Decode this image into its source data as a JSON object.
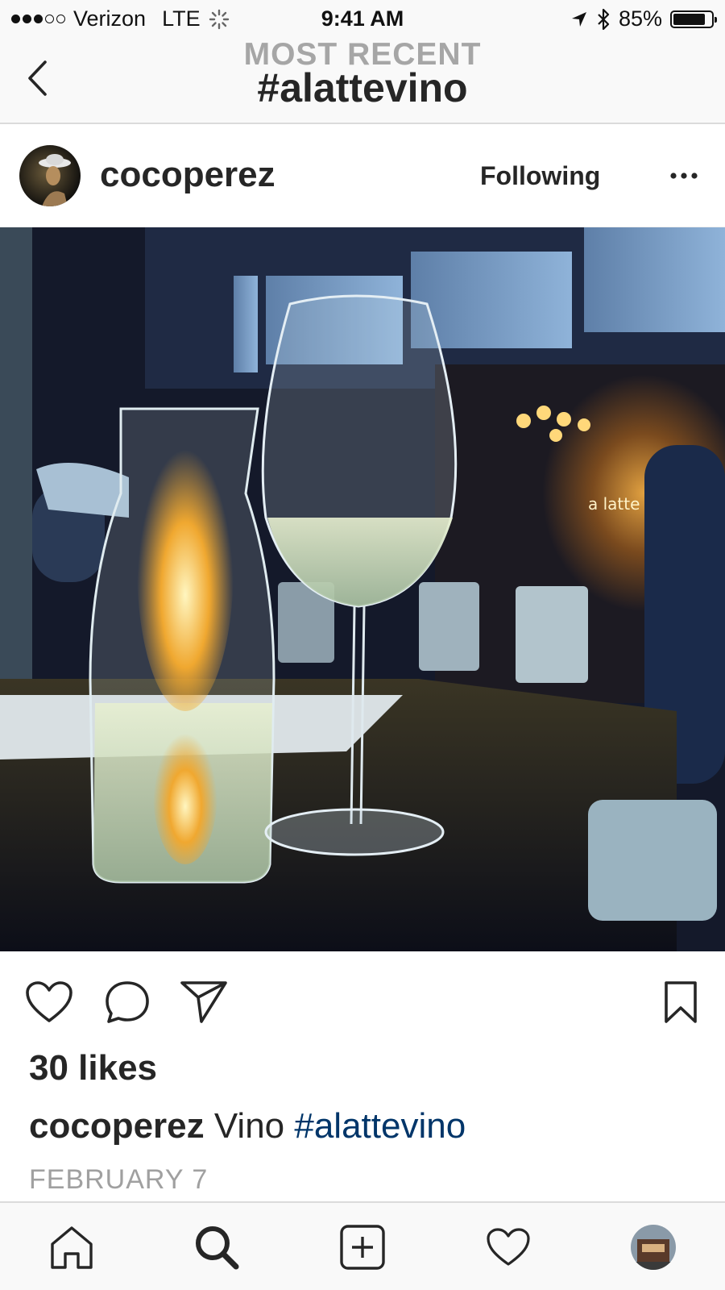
{
  "status_bar": {
    "carrier": "Verizon",
    "network": "LTE",
    "time": "9:41 AM",
    "battery": "85%",
    "battery_level": 0.85,
    "signal_bars_filled": 3,
    "signal_bars_total": 5
  },
  "nav": {
    "subtitle": "MOST RECENT",
    "title": "#alattevino",
    "back_icon": "chevron-left-icon"
  },
  "post": {
    "username": "cocoperez",
    "follow_state": "Following",
    "more_icon": "ellipsis-icon",
    "image_description_icon": "photo",
    "likes": "30 likes",
    "caption": {
      "username": "cocoperez",
      "text": " Vino ",
      "hashtag": "#alattevino"
    },
    "date": "FEBRUARY 7"
  },
  "actions": {
    "like_icon": "heart-icon",
    "comment_icon": "comment-icon",
    "share_icon": "send-icon",
    "save_icon": "bookmark-icon"
  },
  "tabbar": {
    "items": [
      "home-icon",
      "search-icon",
      "add-icon",
      "activity-icon",
      "profile-avatar"
    ],
    "active": "search-icon"
  },
  "colors": {
    "text": "#262626",
    "muted": "#a6a6a6",
    "hashtag": "#003569",
    "bar_bg": "#f9f9f9",
    "divider": "#dbdbdb"
  }
}
